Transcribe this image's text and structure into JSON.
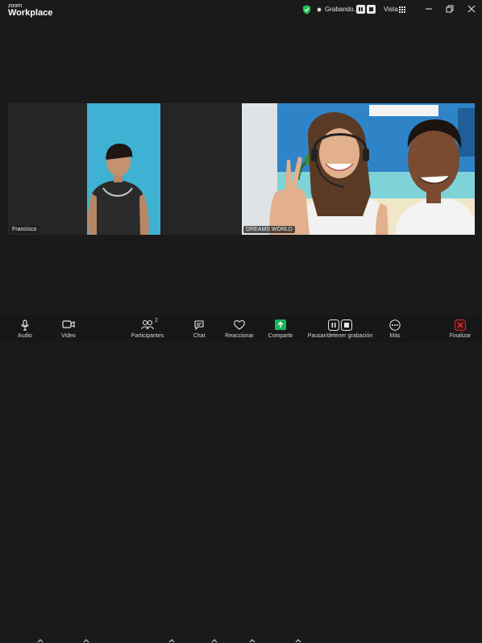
{
  "app": {
    "brand_top": "zoom",
    "brand_main": "Workplace"
  },
  "recording": {
    "label": "Grabando..."
  },
  "view": {
    "label": "Vista"
  },
  "participants": [
    {
      "name": "Francisco"
    },
    {
      "name": "DREAMS WORLD"
    }
  ],
  "toolbar": {
    "audio": "Audio",
    "video": "Video",
    "participants": "Participantes",
    "participants_count": "2",
    "chat": "Chat",
    "react": "Reaccionar",
    "share": "Compartir",
    "pause_stop_recording": "Pausar/detener grabación",
    "more": "Más",
    "end": "Finalizar"
  },
  "colors": {
    "background": "#1a1a1a",
    "share_green": "#19b45a",
    "end_red": "#e02828",
    "shield_green": "#23c552"
  }
}
